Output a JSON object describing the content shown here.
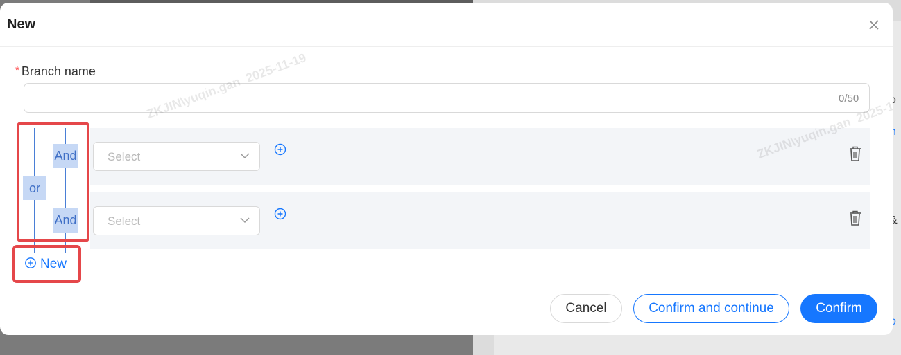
{
  "modal": {
    "title": "New",
    "close_icon": "close-icon"
  },
  "branch_name": {
    "required_mark": "*",
    "label": "Branch name",
    "value": "",
    "placeholder": "",
    "counter": "0/50"
  },
  "logic": {
    "or_label": "or",
    "conditions": [
      {
        "operator": "And",
        "select_placeholder": "Select",
        "add_icon": "plus-circle-icon",
        "delete_icon": "trash-icon"
      },
      {
        "operator": "And",
        "select_placeholder": "Select",
        "add_icon": "plus-circle-icon",
        "delete_icon": "trash-icon"
      }
    ]
  },
  "new_button": {
    "label": "New",
    "icon": "plus-circle-icon"
  },
  "footer": {
    "cancel": "Cancel",
    "confirm_continue": "Confirm and continue",
    "confirm": "Confirm"
  },
  "watermark": {
    "user": "ZKJIN\\yuqin.gan",
    "date": "2025-11-19"
  },
  "colors": {
    "primary": "#1677ff",
    "required": "#ff4d4f",
    "highlight": "#e5474a",
    "tag_bg": "#c6d8f5"
  }
}
